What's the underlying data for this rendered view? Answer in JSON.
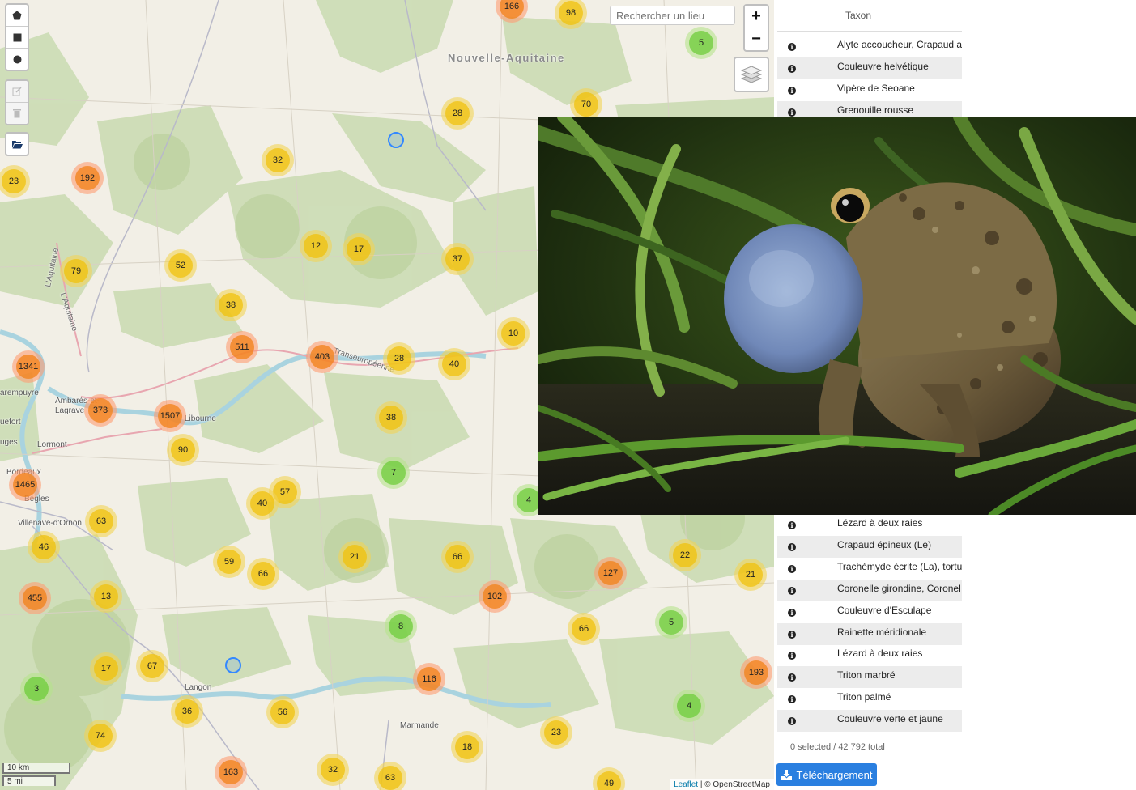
{
  "map": {
    "search_placeholder": "Rechercher un lieu",
    "zoom_in": "+",
    "zoom_out": "−",
    "scale_km": "10 km",
    "scale_mi": "5 mi",
    "attribution_link": "Leaflet",
    "attribution_text": " | © OpenStreetMap",
    "places": {
      "region": "Nouvelle-Aquitaine",
      "road1": "Transeuropéenne",
      "road2": "L'Aquitaine",
      "road3": "L'Aquitaine",
      "carempuyre": "arempuyre",
      "ambares": "Ambarès-et-",
      "lagrave": "Lagrave",
      "libourne": "Libourne",
      "lormont": "Lormont",
      "bordeaux": "Bordeaux",
      "begles": "Bègles",
      "villenave": "Villenave-d'Ornon",
      "bouscat": "uefort",
      "eysines": "uges",
      "langon": "Langon",
      "marmande": "Marmande"
    },
    "clusters": {
      "c166": "166",
      "c98": "98",
      "c5a": "5",
      "c28a": "28",
      "c70": "70",
      "c32a": "32",
      "c23a": "23",
      "c192": "192",
      "c52": "52",
      "c79": "79",
      "c12": "12",
      "c17a": "17",
      "c37": "37",
      "c38a": "38",
      "c10": "10",
      "c511": "511",
      "c403": "403",
      "c28b": "28",
      "c40a": "40",
      "c1341": "1341",
      "c373": "373",
      "c1507": "1507",
      "c38b": "38",
      "c90": "90",
      "c7": "7",
      "c1465": "1465",
      "c57": "57",
      "c40b": "40",
      "c4a": "4",
      "c63a": "63",
      "c46": "46",
      "c59": "59",
      "c66a": "66",
      "c21a": "21",
      "c66b": "66",
      "c22": "22",
      "c21b": "21",
      "c127": "127",
      "c455": "455",
      "c13": "13",
      "c102": "102",
      "c8": "8",
      "c66c": "66",
      "c5b": "5",
      "c17b": "17",
      "c67": "67",
      "c116": "116",
      "c193": "193",
      "c3": "3",
      "c36": "36",
      "c56": "56",
      "c4b": "4",
      "c74": "74",
      "c23b": "23",
      "c18": "18",
      "c163": "163",
      "c32b": "32",
      "c63b": "63",
      "c49": "49"
    }
  },
  "panel": {
    "taxon_header": "Taxon",
    "rows": [
      "Alyte accoucheur, Crapaud ac",
      "Couleuvre helvétique",
      "Vipère de Seoane",
      "Grenouille rousse",
      "Lézard à deux raies",
      "Crapaud épineux (Le)",
      "Trachémyde écrite (La), tortue",
      "Coronelle girondine, Coronel",
      "Couleuvre d'Esculape",
      "Rainette méridionale",
      "Lézard à deux raies",
      "Triton marbré",
      "Triton palmé",
      "Couleuvre verte et jaune"
    ],
    "selection_text": "0 selected / 42 792 total",
    "download_label": "Téléchargement"
  },
  "colors": {
    "cluster_small": "#6ecc39",
    "cluster_medium": "#f0c20c",
    "cluster_large": "#f18017",
    "accent_button": "#2a7fe0",
    "marker_ring": "#3388ff"
  }
}
